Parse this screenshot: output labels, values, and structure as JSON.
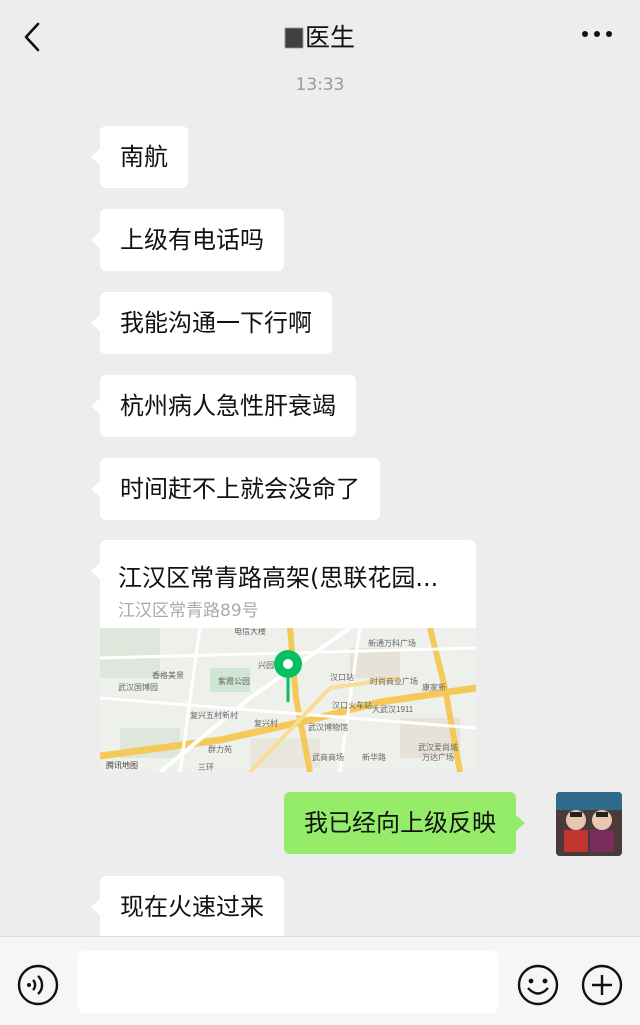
{
  "header": {
    "title": "医生",
    "back_icon": "chevron-left-icon",
    "more_icon": "more-dots-icon"
  },
  "timestamp": "13:33",
  "messages": [
    {
      "side": "left",
      "text": "南航"
    },
    {
      "side": "left",
      "text": "上级有电话吗"
    },
    {
      "side": "left",
      "text": "我能沟通一下行啊"
    },
    {
      "side": "left",
      "text": "杭州病人急性肝衰竭"
    },
    {
      "side": "left",
      "text": "时间赶不上就会没命了"
    },
    {
      "side": "right",
      "text": "我已经向上级反映"
    },
    {
      "side": "left",
      "text": "现在火速过来"
    }
  ],
  "location": {
    "name": "江汉区常青路高架(思联花园...",
    "address": "江汉区常青路89号",
    "map_labels": [
      "电信大楼",
      "新通万科广场",
      "汉口站",
      "时尚商业广场",
      "香格美景",
      "武汉国博园",
      "紫霞公园",
      "兴园",
      "汉口火车站",
      "大武汉1911",
      "康家新",
      "复兴五村新村",
      "复兴村",
      "武汉博物馆",
      "武汉爱尚城",
      "万达广场",
      "群力苑",
      "三环",
      "武商商场",
      "新华路",
      "腾讯地图"
    ]
  },
  "input_bar": {
    "voice_icon": "voice-icon",
    "emoji_icon": "emoji-icon",
    "plus_icon": "plus-icon",
    "input_value": ""
  },
  "colors": {
    "background": "#ededed",
    "bubble_left": "#ffffff",
    "bubble_right": "#95ec69",
    "map_pin": "#07c160"
  }
}
